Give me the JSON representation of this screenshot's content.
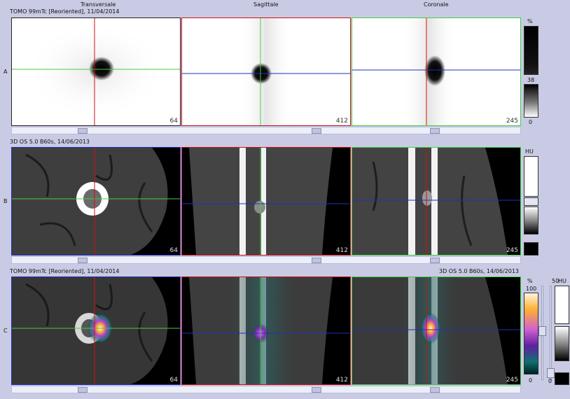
{
  "headers": {
    "transversale": "Transversale",
    "sagittale": "Sagittale",
    "coronale": "Coronale"
  },
  "rows": {
    "a": {
      "label": "A",
      "series": "TOMO 99mTc [Reoriented], 11/04/2014",
      "slices": [
        "64",
        "412",
        "245"
      ]
    },
    "b": {
      "label": "B",
      "series": "3D  OS  5.0  B60s, 14/06/2013",
      "slices": [
        "64",
        "412",
        "245"
      ]
    },
    "c": {
      "label": "C",
      "series_left": "TOMO 99mTc [Reoriented], 11/04/2014",
      "series_right": "3D  OS  5.0  B60s, 14/06/2013",
      "slices": [
        "64",
        "412",
        "245"
      ]
    }
  },
  "scales": {
    "a": {
      "unit": "%",
      "value": "38",
      "min": "0"
    },
    "b": {
      "unit": "HU"
    },
    "c": {
      "unit": "%",
      "max": "100",
      "min": "0",
      "mid": "50",
      "unit2": "HU",
      "min2": "0"
    }
  },
  "colors": {
    "crosshair_red": "#d01010",
    "crosshair_green": "#40d040",
    "crosshair_blue": "#2030c0",
    "background": "#c9cbe4"
  }
}
